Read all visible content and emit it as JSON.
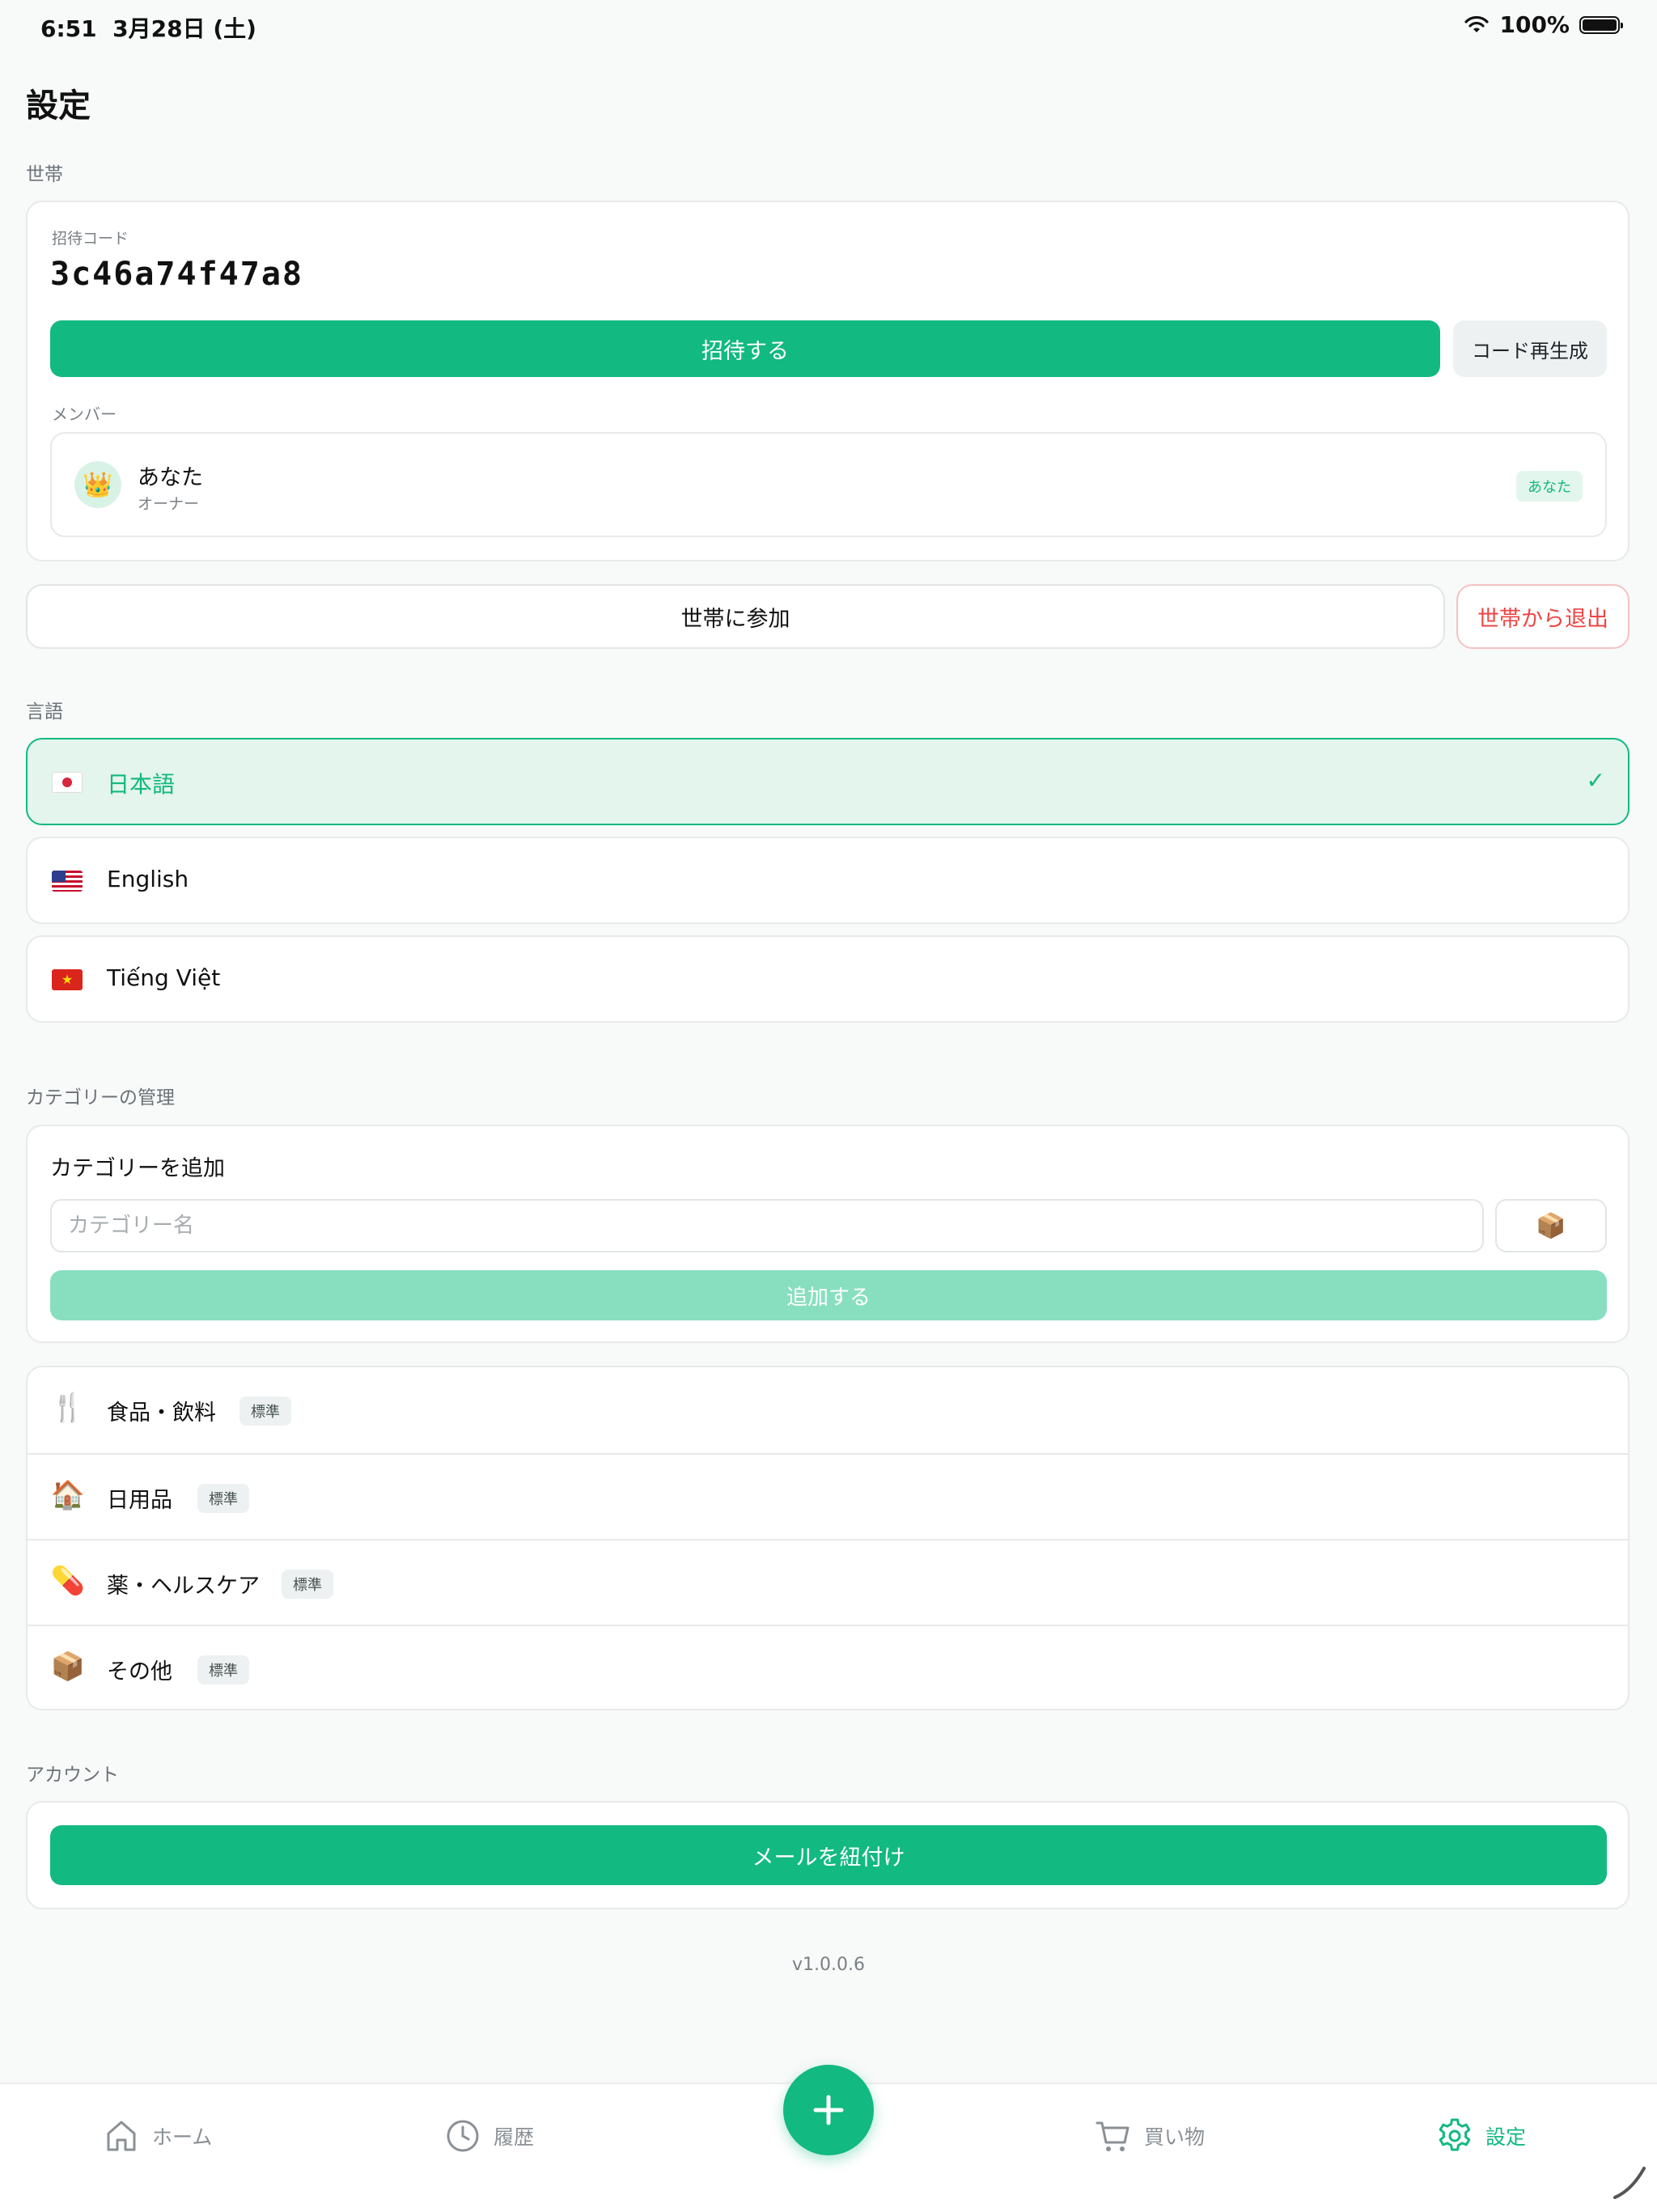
{
  "status_bar": {
    "time": "6:51",
    "date": "3月28日 (土)",
    "battery": "100%"
  },
  "page": {
    "title": "設定"
  },
  "household": {
    "section_label": "世帯",
    "invite_code_label": "招待コード",
    "invite_code": "3c46a74f47a8",
    "invite_button": "招待する",
    "regenerate_button": "コード再生成",
    "members_label": "メンバー",
    "members": [
      {
        "avatar": "👑",
        "name": "あなた",
        "role": "オーナー",
        "badge": "あなた"
      }
    ],
    "join_button": "世帯に参加",
    "leave_button": "世帯から退出"
  },
  "language": {
    "section_label": "言語",
    "options": [
      {
        "flag": "jp",
        "label": "日本語",
        "selected": true,
        "check": "✓"
      },
      {
        "flag": "us",
        "label": "English",
        "selected": false
      },
      {
        "flag": "vn",
        "label": "Tiếng Việt",
        "selected": false
      }
    ]
  },
  "categories": {
    "section_label": "カテゴリーの管理",
    "add_title": "カテゴリーを追加",
    "name_placeholder": "カテゴリー名",
    "default_emoji": "📦",
    "add_button": "追加する",
    "items": [
      {
        "emoji": "🍴",
        "name": "食品・飲料",
        "badge": "標準"
      },
      {
        "emoji": "🏠",
        "name": "日用品",
        "badge": "標準"
      },
      {
        "emoji": "💊",
        "name": "薬・ヘルスケア",
        "badge": "標準"
      },
      {
        "emoji": "📦",
        "name": "その他",
        "badge": "標準"
      }
    ]
  },
  "account": {
    "section_label": "アカウント",
    "link_email_button": "メールを紐付け"
  },
  "version": "v1.0.0.6",
  "tab_bar": {
    "tabs": [
      {
        "label": "ホーム",
        "icon": "home-icon",
        "active": false
      },
      {
        "label": "履歴",
        "icon": "clock-icon",
        "active": false
      },
      {
        "label": "買い物",
        "icon": "cart-icon",
        "active": false
      },
      {
        "label": "設定",
        "icon": "gear-icon",
        "active": true
      }
    ],
    "fab_icon": "plus-icon"
  },
  "colors": {
    "accent": "#12b981",
    "accent_light": "#e3f5ec",
    "danger": "#ef4444",
    "disabled_accent": "#88dfc0"
  }
}
